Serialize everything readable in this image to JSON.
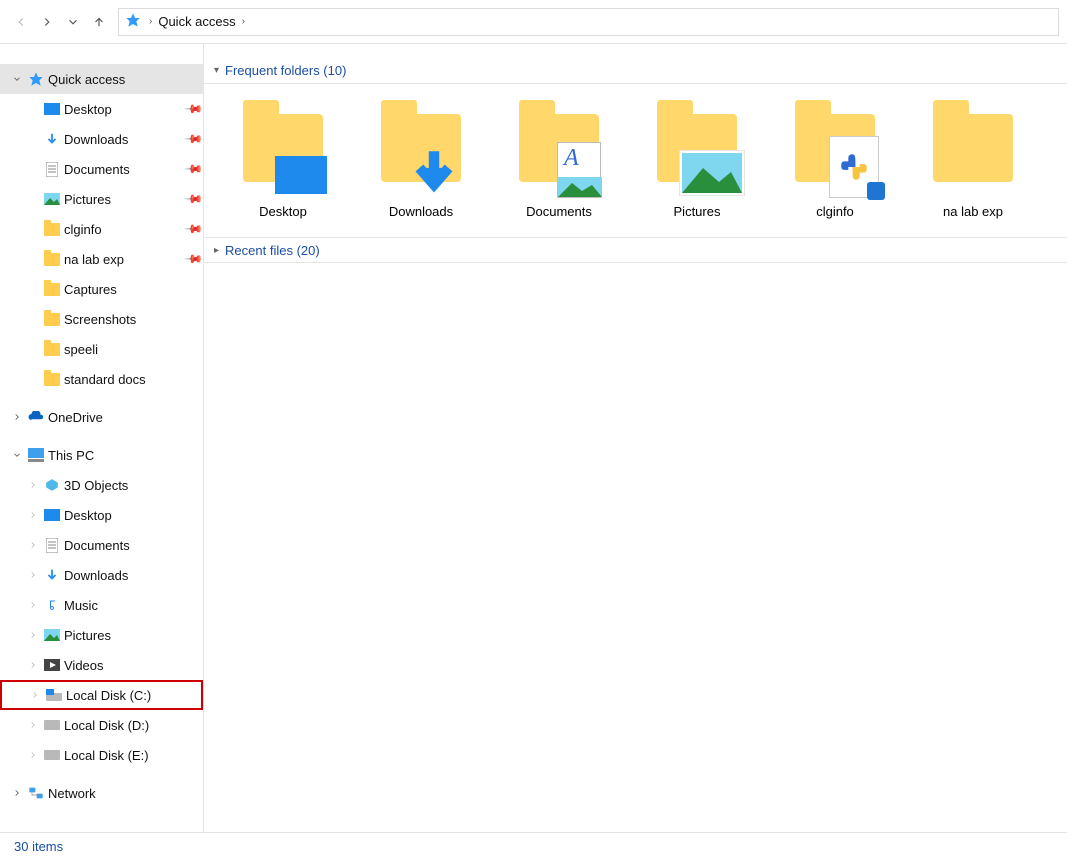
{
  "address": {
    "location": "Quick access"
  },
  "tree": {
    "quick_access": {
      "label": "Quick access",
      "items": [
        {
          "label": "Desktop",
          "pinned": true,
          "icon": "desktop"
        },
        {
          "label": "Downloads",
          "pinned": true,
          "icon": "download"
        },
        {
          "label": "Documents",
          "pinned": true,
          "icon": "document"
        },
        {
          "label": "Pictures",
          "pinned": true,
          "icon": "pictures"
        },
        {
          "label": "clginfo",
          "pinned": true,
          "icon": "folder"
        },
        {
          "label": "na lab exp",
          "pinned": true,
          "icon": "folder"
        },
        {
          "label": "Captures",
          "pinned": false,
          "icon": "folder"
        },
        {
          "label": "Screenshots",
          "pinned": false,
          "icon": "folder"
        },
        {
          "label": "speeli",
          "pinned": false,
          "icon": "folder"
        },
        {
          "label": "standard docs",
          "pinned": false,
          "icon": "folder"
        }
      ]
    },
    "onedrive": {
      "label": "OneDrive"
    },
    "this_pc": {
      "label": "This PC",
      "items": [
        {
          "label": "3D Objects",
          "icon": "3d"
        },
        {
          "label": "Desktop",
          "icon": "desktop"
        },
        {
          "label": "Documents",
          "icon": "document"
        },
        {
          "label": "Downloads",
          "icon": "download"
        },
        {
          "label": "Music",
          "icon": "music"
        },
        {
          "label": "Pictures",
          "icon": "pictures"
        },
        {
          "label": "Videos",
          "icon": "videos"
        },
        {
          "label": "Local Disk (C:)",
          "icon": "disk",
          "highlighted": true
        },
        {
          "label": "Local Disk (D:)",
          "icon": "disk"
        },
        {
          "label": "Local Disk (E:)",
          "icon": "disk"
        }
      ]
    },
    "network": {
      "label": "Network"
    }
  },
  "sections": {
    "frequent": {
      "title": "Frequent folders (10)"
    },
    "recent": {
      "title": "Recent files (20)"
    }
  },
  "tiles": [
    {
      "label": "Desktop",
      "icon": "desktop-folder"
    },
    {
      "label": "Downloads",
      "icon": "download-folder"
    },
    {
      "label": "Documents",
      "icon": "document-folder"
    },
    {
      "label": "Pictures",
      "icon": "pictures-folder"
    },
    {
      "label": "clginfo",
      "icon": "py-folder"
    },
    {
      "label": "na lab exp",
      "icon": "folder"
    }
  ],
  "status": {
    "text": "30 items"
  }
}
